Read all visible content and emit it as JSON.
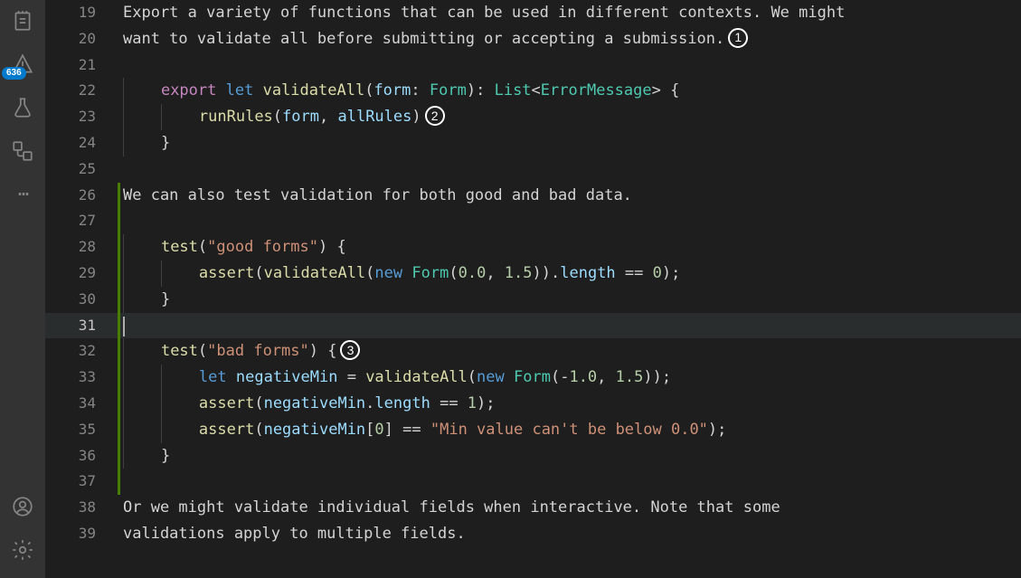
{
  "activity": {
    "notepad_icon": "notepad",
    "test_icon": "test-triangle",
    "test_badge": "636",
    "beaker_icon": "beaker",
    "flow_icon": "flowchart",
    "more_icon": "…",
    "account_icon": "account",
    "gear_icon": "settings"
  },
  "editor": {
    "current_line": 31,
    "lines": [
      {
        "n": 19,
        "mod": false,
        "tokens": [
          {
            "t": "Export a variety of functions that can be used in different contexts. We might",
            "c": "txt"
          }
        ]
      },
      {
        "n": 20,
        "mod": false,
        "tokens": [
          {
            "t": "want to validate all before submitting or accepting a submission.",
            "c": "txt"
          }
        ],
        "annot": "1"
      },
      {
        "n": 21,
        "mod": false,
        "tokens": []
      },
      {
        "n": 22,
        "mod": false,
        "indent": 1,
        "tokens": [
          {
            "t": "export",
            "c": "kw"
          },
          {
            "t": " ",
            "c": ""
          },
          {
            "t": "let",
            "c": "kw2"
          },
          {
            "t": " ",
            "c": ""
          },
          {
            "t": "validateAll",
            "c": "fn"
          },
          {
            "t": "(",
            "c": "pt"
          },
          {
            "t": "form",
            "c": "vr"
          },
          {
            "t": ":",
            "c": "pt"
          },
          {
            "t": " ",
            "c": ""
          },
          {
            "t": "Form",
            "c": "ty"
          },
          {
            "t": ")",
            "c": "pt"
          },
          {
            "t": ":",
            "c": "pt"
          },
          {
            "t": " ",
            "c": ""
          },
          {
            "t": "List",
            "c": "ty"
          },
          {
            "t": "<",
            "c": "pt"
          },
          {
            "t": "ErrorMessage",
            "c": "ty"
          },
          {
            "t": ">",
            "c": "pt"
          },
          {
            "t": " {",
            "c": "pt"
          }
        ]
      },
      {
        "n": 23,
        "mod": false,
        "indent": 2,
        "tokens": [
          {
            "t": "runRules",
            "c": "fn"
          },
          {
            "t": "(",
            "c": "pt"
          },
          {
            "t": "form",
            "c": "vr"
          },
          {
            "t": ", ",
            "c": "pt"
          },
          {
            "t": "allRules",
            "c": "vr"
          },
          {
            "t": ")",
            "c": "pt"
          }
        ],
        "annot": "2"
      },
      {
        "n": 24,
        "mod": false,
        "indent": 1,
        "tokens": [
          {
            "t": "}",
            "c": "pt"
          }
        ]
      },
      {
        "n": 25,
        "mod": false,
        "tokens": []
      },
      {
        "n": 26,
        "mod": true,
        "tokens": [
          {
            "t": "We can also test validation for both good and bad data.",
            "c": "txt"
          }
        ]
      },
      {
        "n": 27,
        "mod": true,
        "tokens": []
      },
      {
        "n": 28,
        "mod": true,
        "indent": 1,
        "tokens": [
          {
            "t": "test",
            "c": "fn"
          },
          {
            "t": "(",
            "c": "pt"
          },
          {
            "t": "\"good forms\"",
            "c": "str"
          },
          {
            "t": ")",
            "c": "pt"
          },
          {
            "t": " {",
            "c": "pt"
          }
        ]
      },
      {
        "n": 29,
        "mod": true,
        "indent": 2,
        "tokens": [
          {
            "t": "assert",
            "c": "fn"
          },
          {
            "t": "(",
            "c": "pt"
          },
          {
            "t": "validateAll",
            "c": "fn"
          },
          {
            "t": "(",
            "c": "pt"
          },
          {
            "t": "new",
            "c": "kw2"
          },
          {
            "t": " ",
            "c": ""
          },
          {
            "t": "Form",
            "c": "ty"
          },
          {
            "t": "(",
            "c": "pt"
          },
          {
            "t": "0.0",
            "c": "num-lit"
          },
          {
            "t": ", ",
            "c": "pt"
          },
          {
            "t": "1.5",
            "c": "num-lit"
          },
          {
            "t": "))",
            "c": "pt"
          },
          {
            "t": ".",
            "c": "pt"
          },
          {
            "t": "length",
            "c": "vr"
          },
          {
            "t": " == ",
            "c": "pt"
          },
          {
            "t": "0",
            "c": "num-lit"
          },
          {
            "t": ");",
            "c": "pt"
          }
        ]
      },
      {
        "n": 30,
        "mod": true,
        "indent": 1,
        "tokens": [
          {
            "t": "}",
            "c": "pt"
          }
        ]
      },
      {
        "n": 31,
        "mod": true,
        "selected": true,
        "cursor": true,
        "indent": 0,
        "tokens": []
      },
      {
        "n": 32,
        "mod": true,
        "indent": 1,
        "tokens": [
          {
            "t": "test",
            "c": "fn"
          },
          {
            "t": "(",
            "c": "pt"
          },
          {
            "t": "\"bad forms\"",
            "c": "str"
          },
          {
            "t": ")",
            "c": "pt"
          },
          {
            "t": " {",
            "c": "pt"
          }
        ],
        "annot": "3"
      },
      {
        "n": 33,
        "mod": true,
        "indent": 2,
        "tokens": [
          {
            "t": "let",
            "c": "kw2"
          },
          {
            "t": " ",
            "c": ""
          },
          {
            "t": "negativeMin",
            "c": "vr"
          },
          {
            "t": " = ",
            "c": "pt"
          },
          {
            "t": "validateAll",
            "c": "fn"
          },
          {
            "t": "(",
            "c": "pt"
          },
          {
            "t": "new",
            "c": "kw2"
          },
          {
            "t": " ",
            "c": ""
          },
          {
            "t": "Form",
            "c": "ty"
          },
          {
            "t": "(",
            "c": "pt"
          },
          {
            "t": "-",
            "c": "pt"
          },
          {
            "t": "1.0",
            "c": "num-lit"
          },
          {
            "t": ", ",
            "c": "pt"
          },
          {
            "t": "1.5",
            "c": "num-lit"
          },
          {
            "t": "));",
            "c": "pt"
          }
        ]
      },
      {
        "n": 34,
        "mod": true,
        "indent": 2,
        "tokens": [
          {
            "t": "assert",
            "c": "fn"
          },
          {
            "t": "(",
            "c": "pt"
          },
          {
            "t": "negativeMin",
            "c": "vr"
          },
          {
            "t": ".",
            "c": "pt"
          },
          {
            "t": "length",
            "c": "vr"
          },
          {
            "t": " == ",
            "c": "pt"
          },
          {
            "t": "1",
            "c": "num-lit"
          },
          {
            "t": ");",
            "c": "pt"
          }
        ]
      },
      {
        "n": 35,
        "mod": true,
        "indent": 2,
        "tokens": [
          {
            "t": "assert",
            "c": "fn"
          },
          {
            "t": "(",
            "c": "pt"
          },
          {
            "t": "negativeMin",
            "c": "vr"
          },
          {
            "t": "[",
            "c": "pt"
          },
          {
            "t": "0",
            "c": "num-lit"
          },
          {
            "t": "]",
            "c": "pt"
          },
          {
            "t": " == ",
            "c": "pt"
          },
          {
            "t": "\"Min value can't be below 0.0\"",
            "c": "str"
          },
          {
            "t": ");",
            "c": "pt"
          }
        ]
      },
      {
        "n": 36,
        "mod": true,
        "indent": 1,
        "tokens": [
          {
            "t": "}",
            "c": "pt"
          }
        ]
      },
      {
        "n": 37,
        "mod": true,
        "tokens": []
      },
      {
        "n": 38,
        "mod": false,
        "tokens": [
          {
            "t": "Or we might validate individual fields when interactive. Note that some",
            "c": "txt"
          }
        ]
      },
      {
        "n": 39,
        "mod": false,
        "tokens": [
          {
            "t": "validations apply to multiple fields.",
            "c": "txt"
          }
        ]
      }
    ]
  }
}
